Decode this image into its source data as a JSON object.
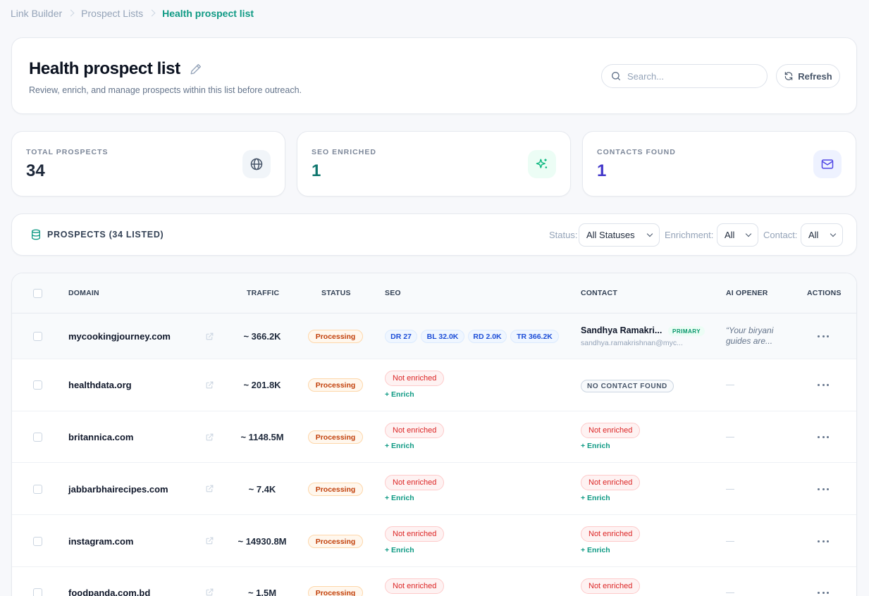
{
  "breadcrumb": {
    "items": [
      "Link Builder",
      "Prospect Lists"
    ],
    "current": "Health prospect list"
  },
  "header": {
    "title": "Health prospect list",
    "subtitle": "Review, enrich, and manage prospects within this list before outreach.",
    "search_placeholder": "Search...",
    "refresh_label": "Refresh"
  },
  "stats": [
    {
      "label": "TOTAL PROSPECTS",
      "value": "34",
      "icon": "globe-icon",
      "color": "#1e293b",
      "icon_bg": "#f1f5f9",
      "icon_color": "#475569"
    },
    {
      "label": "SEO ENRICHED",
      "value": "1",
      "icon": "sparkle-icon",
      "color": "#0f766e",
      "icon_bg": "#ecfdf5",
      "icon_color": "#10b981"
    },
    {
      "label": "CONTACTS FOUND",
      "value": "1",
      "icon": "mail-icon",
      "color": "#4338ca",
      "icon_bg": "#eef2ff",
      "icon_color": "#4f46e5"
    }
  ],
  "filters": {
    "title": "PROSPECTS (34 LISTED)",
    "status_label": "Status:",
    "status_value": "All Statuses",
    "enrichment_label": "Enrichment:",
    "enrichment_value": "All",
    "contact_label": "Contact:",
    "contact_value": "All"
  },
  "table": {
    "columns": [
      "DOMAIN",
      "TRAFFIC",
      "STATUS",
      "SEO",
      "CONTACT",
      "AI OPENER",
      "ACTIONS"
    ],
    "rows": [
      {
        "domain": "mycookingjourney.com",
        "traffic": "~ 366.2K",
        "status": "Processing",
        "seo": [
          "DR 27",
          "BL 32.0K",
          "RD 2.0K",
          "TR 366.2K"
        ],
        "contact_name": "Sandhya Ramakri...",
        "contact_badge": "PRIMARY",
        "contact_email": "sandhya.ramakrishnan@myc...",
        "ai_opener": "“Your biryani guides are..."
      },
      {
        "domain": "healthdata.org",
        "traffic": "~ 201.8K",
        "status": "Processing",
        "seo_status": "Not enriched",
        "seo_action": "+ Enrich",
        "contact_status": "NO CONTACT FOUND",
        "ai_opener": "—"
      },
      {
        "domain": "britannica.com",
        "traffic": "~ 1148.5M",
        "status": "Processing",
        "seo_status": "Not enriched",
        "seo_action": "+ Enrich",
        "contact_status": "Not enriched",
        "contact_action": "+ Enrich",
        "ai_opener": "—"
      },
      {
        "domain": "jabbarbhairecipes.com",
        "traffic": "~ 7.4K",
        "status": "Processing",
        "seo_status": "Not enriched",
        "seo_action": "+ Enrich",
        "contact_status": "Not enriched",
        "contact_action": "+ Enrich",
        "ai_opener": "—"
      },
      {
        "domain": "instagram.com",
        "traffic": "~ 14930.8M",
        "status": "Processing",
        "seo_status": "Not enriched",
        "seo_action": "+ Enrich",
        "contact_status": "Not enriched",
        "contact_action": "+ Enrich",
        "ai_opener": "—"
      },
      {
        "domain": "foodpanda.com.bd",
        "traffic": "~ 1.5M",
        "status": "Processing",
        "seo_status": "Not enriched",
        "contact_status": "Not enriched",
        "ai_opener": "—"
      }
    ]
  }
}
